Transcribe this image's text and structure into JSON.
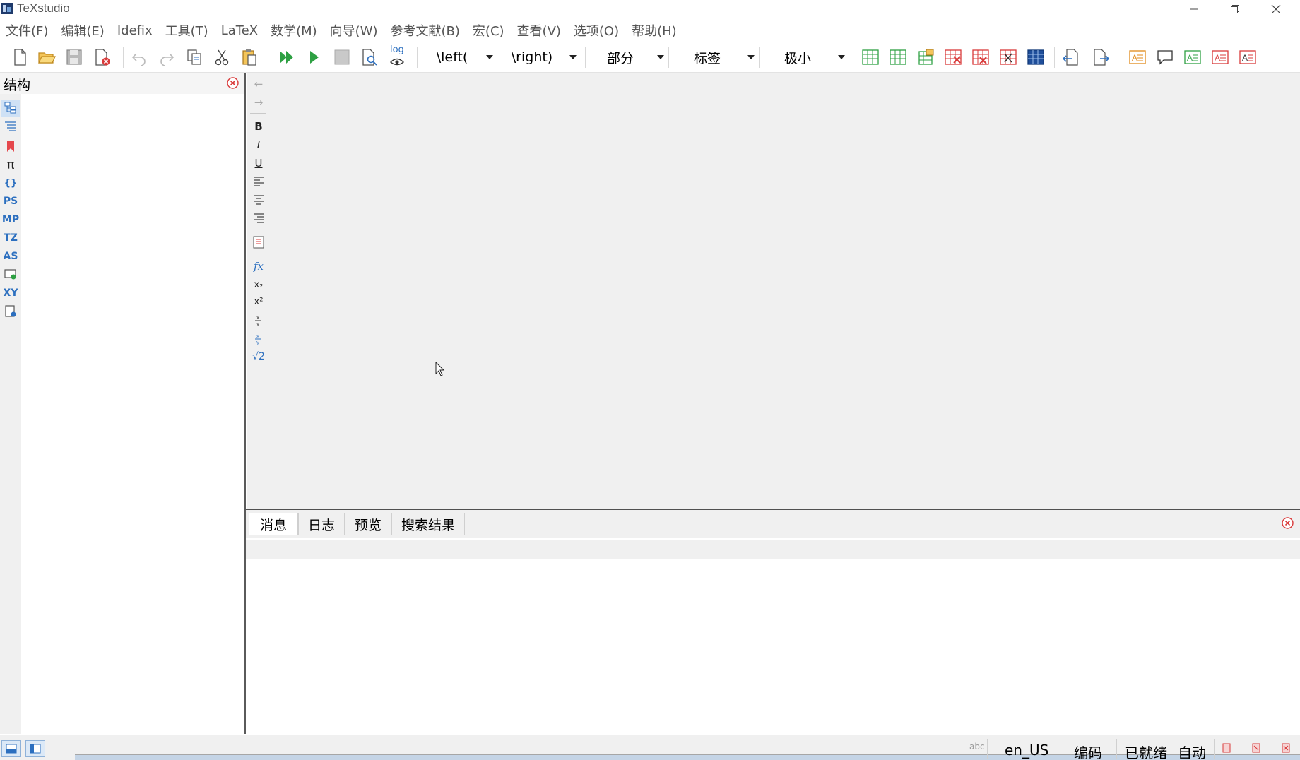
{
  "window": {
    "title": "TeXstudio"
  },
  "menu": [
    "文件(F)",
    "编辑(E)",
    "Idefix",
    "工具(T)",
    "LaTeX",
    "数学(M)",
    "向导(W)",
    "参考文献(B)",
    "宏(C)",
    "查看(V)",
    "选项(O)",
    "帮助(H)"
  ],
  "toolbar": {
    "combos": {
      "left": "\\left(",
      "right": "\\right)",
      "section": "部分",
      "label": "标签",
      "size": "极小"
    },
    "log_label": "log"
  },
  "structure_panel": {
    "title": "结构",
    "side_buttons": [
      "PS",
      "MP",
      "TZ",
      "AS",
      "XY"
    ]
  },
  "message_panel": {
    "tabs": [
      "消息",
      "日志",
      "预览",
      "搜索结果"
    ],
    "active_tab": 0
  },
  "statusbar": {
    "abc": "abc",
    "language": "en_US",
    "encoding": "编码",
    "status": "已就绪",
    "mode": "自动"
  },
  "colors": {
    "accent": "#2c6fbf",
    "green": "#2ea043",
    "red": "#d93a3a"
  }
}
